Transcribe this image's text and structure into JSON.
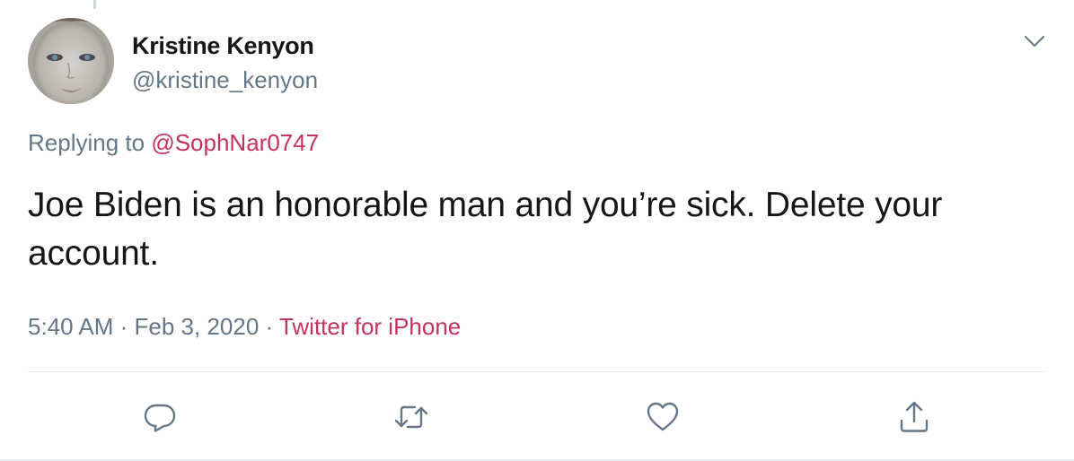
{
  "tweet": {
    "author": {
      "display_name": "Kristine Kenyon",
      "handle": "@kristine_kenyon",
      "avatar_icon": "profile-photo"
    },
    "reply": {
      "prefix": "Replying to ",
      "mention": "@SophNar0747"
    },
    "text": "Joe Biden is an honorable man and you’re sick. Delete your account.",
    "meta": {
      "time": "5:40 AM",
      "separator1": " · ",
      "date": "Feb 3, 2020",
      "separator2": " · ",
      "source": "Twitter for iPhone"
    },
    "actions": {
      "reply_icon": "reply-icon",
      "retweet_icon": "retweet-icon",
      "like_icon": "heart-icon",
      "share_icon": "share-icon"
    },
    "menu_icon": "chevron-down-icon"
  },
  "colors": {
    "text_primary": "#14171a",
    "text_secondary": "#657786",
    "link": "#c4335c",
    "divider": "#e6ecf0"
  }
}
